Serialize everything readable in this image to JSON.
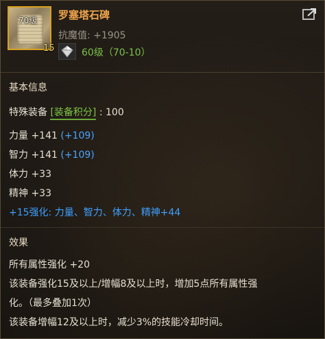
{
  "item": {
    "level_badge": "70级",
    "count_badge": "15",
    "name": "罗塞塔石碑",
    "stat_line": "抗魔值: +1905",
    "level_range": "60级（70-10）"
  },
  "basic": {
    "title": "基本信息",
    "special_label": "特殊装备",
    "special_tag": "[装备积分]",
    "special_value": ": 100",
    "stats": [
      {
        "text": "力量 +141",
        "bonus": "(+109)"
      },
      {
        "text": "智力 +141",
        "bonus": "(+109)"
      },
      {
        "text": "体力 +33",
        "bonus": ""
      },
      {
        "text": "精神 +33",
        "bonus": ""
      }
    ],
    "strength_line": "+15强化: 力量、智力、体力、精神+44"
  },
  "effect": {
    "title": "效果",
    "lines": [
      "所有属性强化 +20",
      "该装备强化15及以上/增幅8及以上时，增加5点所有属性强",
      "化。（最多叠加1次）",
      "该装备增幅12及以上时，减少3%的技能冷却时间。"
    ]
  },
  "colors": {
    "name": "#f2a64a",
    "level": "#79c24a",
    "tag": "#7fc743",
    "bonus": "#4aa3ff",
    "border": "#d9a21f"
  },
  "icons": {
    "item": "scroll-icon",
    "grade": "diamond-icon",
    "corner": "share-icon"
  }
}
